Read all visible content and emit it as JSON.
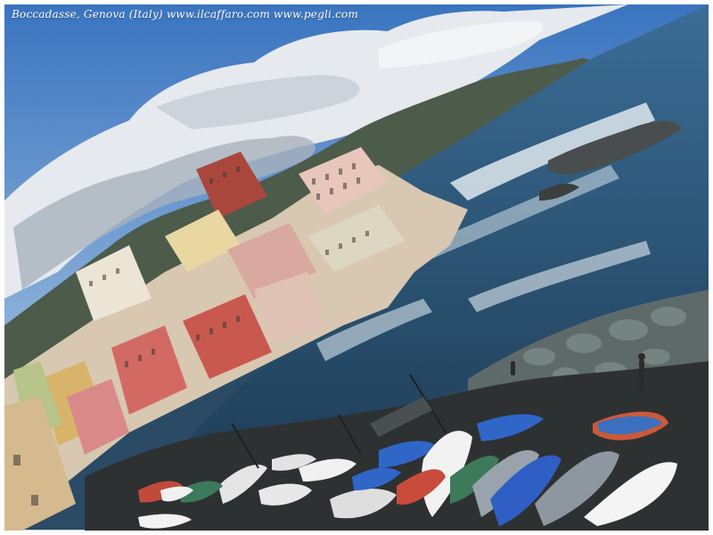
{
  "caption": {
    "text": "Boccadasse, Genova (Italy)  www.ilcaffaro.com  www.pegli.com"
  },
  "scene": {
    "subject": "coastal village with colorful houses, rocks, stormy sea and beached boats",
    "colors": {
      "sky": "#4f86c6",
      "cloud": "#e9ecef",
      "cloud_shadow": "#8c96a3",
      "mountains": "#4b5a4a",
      "sea": "#2f5878",
      "sea_light": "#5f8aa9",
      "foam": "#e8eef2",
      "rock": "#59636a",
      "beach": "#2b2d2e",
      "house_pink": "#d9a4a2",
      "house_red": "#b6564d",
      "house_yellow": "#e6cc86",
      "house_cream": "#e9e1d1",
      "boat_blue": "#2f66c8",
      "boat_white": "#f2f2f2",
      "boat_gray": "#8e96a0"
    }
  }
}
